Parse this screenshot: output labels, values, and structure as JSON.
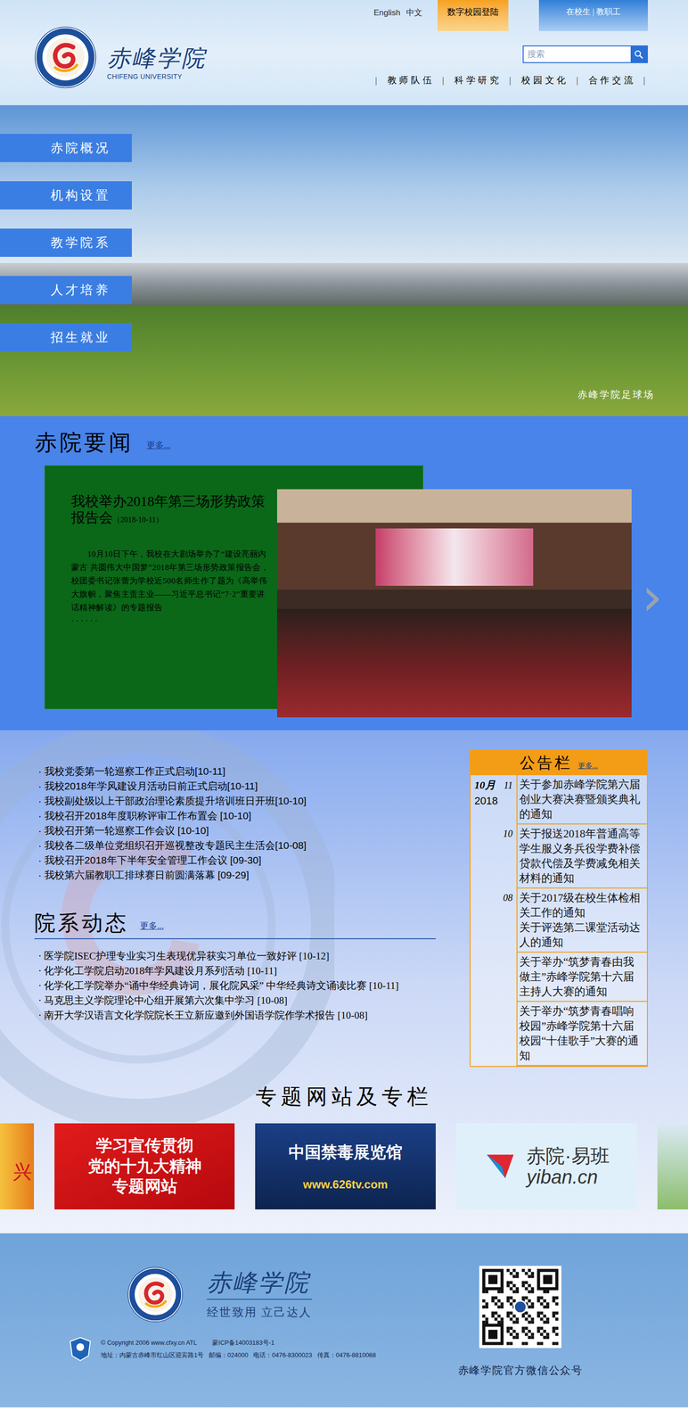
{
  "header": {
    "logo_name": "赤峰学院",
    "logo_en": "CHIFENG UNIVERSITY",
    "languages": [
      "English",
      "中文"
    ],
    "portal_button": "数字校园登陆",
    "user_button": "在校生 | 教职工",
    "search_placeholder": "搜索",
    "nav": [
      "教师队伍",
      "科学研究",
      "校园文化",
      "合作交流"
    ]
  },
  "hero": {
    "caption": "赤峰学院足球场",
    "menu": [
      "赤院概况",
      "机构设置",
      "教学院系",
      "人才培养",
      "招生就业"
    ]
  },
  "news": {
    "title": "赤院要闻",
    "more": "更多...",
    "feature": {
      "title": "我校举办2018年第三场形势政策报告会",
      "date": "（2018-10-11）",
      "body": "10月10日下午，我校在大剧场举办了“建设亮丽内蒙古 共圆伟大中国梦”2018年第三场形势政策报告会，校团委书记张蕾为学校近500名师生作了题为《高举伟大旗帜，聚焦主责主业——习近平总书记“7·2”重要讲话精神解读》的专题报告",
      "ellipsis": "· · · · · ·"
    },
    "next_arrow": "›",
    "items": [
      "我校党委第一轮巡察工作正式启动[10-11]",
      "我校2018年学风建设月活动日前正式启动[10-11]",
      "我校副处级以上干部政治理论素质提升培训班日开班[10-10]",
      "我校召开2018年度职称评审工作布置会 [10-10]",
      "我校召开第一轮巡察工作会议 [10-10]",
      "我校各二级单位党组织召开巡视整改专题民主生活会[10-08]",
      "我校召开2018年下半年安全管理工作会议 [09-30]",
      "我校第六届教职工排球赛日前圆满落幕 [09-29]"
    ]
  },
  "notices": {
    "title": "公告栏",
    "more": "更多...",
    "items": [
      {
        "month": "10月",
        "year": "2018",
        "day": "11",
        "texts": [
          "关于参加赤峰学院第六届创业大赛决赛暨颁奖典礼的通知"
        ]
      },
      {
        "month": "",
        "year": "",
        "day": "10",
        "texts": [
          "关于报送2018年普通高等学生服义务兵役学费补偿贷款代偿及学费减免相关材料的通知"
        ]
      },
      {
        "month": "",
        "year": "",
        "day": "08",
        "texts": [
          "关于2017级在校生体检相关工作的通知",
          "关于评选第二课堂活动达人的通知"
        ]
      },
      {
        "month": "",
        "year": "",
        "day": "",
        "texts": [
          "关于举办“筑梦青春由我做主”赤峰学院第十六届主持人大赛的通知"
        ]
      },
      {
        "month": "",
        "year": "",
        "day": "",
        "texts": [
          "关于举办“筑梦青春唱响校园”赤峰学院第十六届校园“十佳歌手”大赛的通知"
        ]
      }
    ]
  },
  "dept": {
    "title": "院系动态",
    "more": "更多...",
    "items": [
      "医学院ISEC护理专业实习生表现优异获实习单位一致好评 [10-12]",
      "化学化工学院启动2018年学风建设月系列活动 [10-11]",
      "化学化工学院举办“诵中华经典诗词，展化院风采” 中华经典诗文诵读比赛 [10-11]",
      "马克思主义学院理论中心组开展第六次集中学习 [10-08]",
      "南开大学汉语言文化学院院长王立新应邀到外国语学院作学术报告 [10-08]"
    ]
  },
  "specials": {
    "title": "专题网站及专栏",
    "left_edge": "兴",
    "banners": [
      {
        "lines": [
          "学习宣传贯彻",
          "党的十九大精神",
          "专题网站"
        ],
        "kind": "party"
      },
      {
        "lines": [
          "中国禁毒展览馆",
          "www.626tv.com"
        ],
        "kind": "drug"
      },
      {
        "lines": [
          "赤院·易班",
          "yiban.cn"
        ],
        "kind": "yiban"
      }
    ]
  },
  "footer": {
    "logo_name": "赤峰学院",
    "motto": "经世致用 立己达人",
    "copyright": "© Copyright 2006 www.cfxy.cn ATL",
    "icp": "蒙ICP备14003183号-1",
    "address": "地址：内蒙古赤峰市红山区迎宾路1号   邮编：024000   电话：0476-8300023   传真：0476-8810068",
    "qr_caption": "赤峰学院官方微信公众号"
  }
}
